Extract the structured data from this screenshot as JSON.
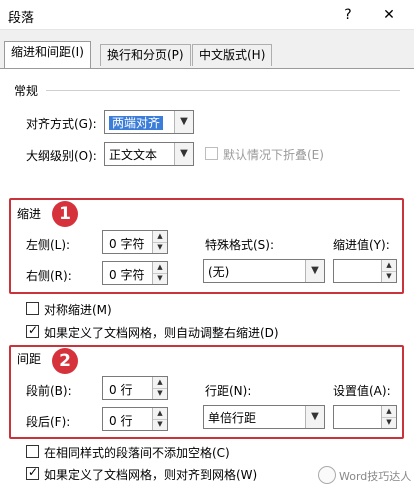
{
  "window": {
    "title": "段落",
    "help_glyph": "?",
    "close_glyph": "✕"
  },
  "tabs": [
    {
      "label": "缩进和间距(I)",
      "active": true
    },
    {
      "label": "换行和分页(P)",
      "active": false
    },
    {
      "label": "中文版式(H)",
      "active": false
    }
  ],
  "general": {
    "heading": "常规",
    "align_label": "对齐方式(G):",
    "align_value": "两端对齐",
    "outline_label": "大纲级别(O):",
    "outline_value": "正文文本",
    "collapse_label": "默认情况下折叠(E)"
  },
  "indent": {
    "heading": "缩进",
    "badge": "1",
    "left_label": "左侧(L):",
    "left_value": "0 字符",
    "right_label": "右侧(R):",
    "right_value": "0 字符",
    "special_label": "特殊格式(S):",
    "special_value": "(无)",
    "indent_value_label": "缩进值(Y):",
    "indent_value": "",
    "mirror_label": "对称缩进(M)",
    "auto_adjust_label": "如果定义了文档网格，则自动调整右缩进(D)"
  },
  "spacing": {
    "heading": "间距",
    "badge": "2",
    "before_label": "段前(B):",
    "before_value": "0 行",
    "after_label": "段后(F):",
    "after_value": "0 行",
    "line_label": "行距(N):",
    "line_value": "单倍行距",
    "setting_label": "设置值(A):",
    "setting_value": "",
    "no_space_label": "在相同样式的段落间不添加空格(C)",
    "snap_grid_label": "如果定义了文档网格，则对齐到网格(W)"
  },
  "watermark": {
    "text": "Word技巧达人"
  },
  "colors": {
    "highlight": "#c9333b",
    "selection": "#3b7dd8"
  }
}
